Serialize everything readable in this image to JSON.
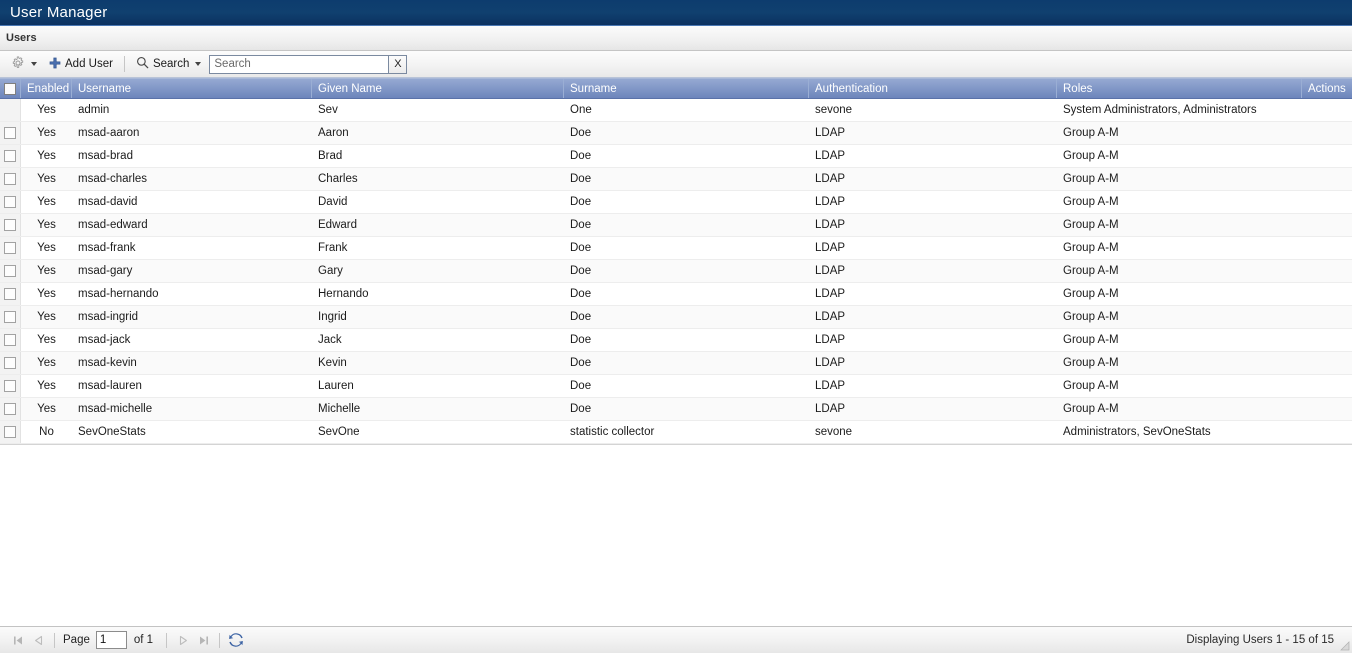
{
  "window": {
    "title": "User Manager"
  },
  "section": {
    "title": "Users"
  },
  "toolbar": {
    "settings_icon": "gear-icon",
    "settings_caret": "chevron-down-icon",
    "add_user_icon": "plus-icon",
    "add_user_label": "Add User",
    "search_icon": "magnifier-icon",
    "search_menu_label": "Search",
    "search_menu_caret": "chevron-down-icon",
    "search_value": "",
    "search_placeholder": "Search",
    "clear_label": "X"
  },
  "grid": {
    "columns": [
      {
        "key": "check",
        "label": ""
      },
      {
        "key": "enabled",
        "label": "Enabled"
      },
      {
        "key": "username",
        "label": "Username"
      },
      {
        "key": "given",
        "label": "Given Name"
      },
      {
        "key": "surname",
        "label": "Surname"
      },
      {
        "key": "auth",
        "label": "Authentication"
      },
      {
        "key": "roles",
        "label": "Roles"
      },
      {
        "key": "actions",
        "label": "Actions"
      }
    ],
    "select_all_checked": false,
    "rows": [
      {
        "checkbox": false,
        "enabled": "Yes",
        "username": "admin",
        "given": "Sev",
        "surname": "One",
        "auth": "sevone",
        "roles": "System Administrators, Administrators",
        "actions": ""
      },
      {
        "checkbox": true,
        "enabled": "Yes",
        "username": "msad-aaron",
        "given": "Aaron",
        "surname": "Doe",
        "auth": "LDAP",
        "roles": "Group A-M",
        "actions": ""
      },
      {
        "checkbox": true,
        "enabled": "Yes",
        "username": "msad-brad",
        "given": "Brad",
        "surname": "Doe",
        "auth": "LDAP",
        "roles": "Group A-M",
        "actions": ""
      },
      {
        "checkbox": true,
        "enabled": "Yes",
        "username": "msad-charles",
        "given": "Charles",
        "surname": "Doe",
        "auth": "LDAP",
        "roles": "Group A-M",
        "actions": ""
      },
      {
        "checkbox": true,
        "enabled": "Yes",
        "username": "msad-david",
        "given": "David",
        "surname": "Doe",
        "auth": "LDAP",
        "roles": "Group A-M",
        "actions": ""
      },
      {
        "checkbox": true,
        "enabled": "Yes",
        "username": "msad-edward",
        "given": "Edward",
        "surname": "Doe",
        "auth": "LDAP",
        "roles": "Group A-M",
        "actions": ""
      },
      {
        "checkbox": true,
        "enabled": "Yes",
        "username": "msad-frank",
        "given": "Frank",
        "surname": "Doe",
        "auth": "LDAP",
        "roles": "Group A-M",
        "actions": ""
      },
      {
        "checkbox": true,
        "enabled": "Yes",
        "username": "msad-gary",
        "given": "Gary",
        "surname": "Doe",
        "auth": "LDAP",
        "roles": "Group A-M",
        "actions": ""
      },
      {
        "checkbox": true,
        "enabled": "Yes",
        "username": "msad-hernando",
        "given": "Hernando",
        "surname": "Doe",
        "auth": "LDAP",
        "roles": "Group A-M",
        "actions": ""
      },
      {
        "checkbox": true,
        "enabled": "Yes",
        "username": "msad-ingrid",
        "given": "Ingrid",
        "surname": "Doe",
        "auth": "LDAP",
        "roles": "Group A-M",
        "actions": ""
      },
      {
        "checkbox": true,
        "enabled": "Yes",
        "username": "msad-jack",
        "given": "Jack",
        "surname": "Doe",
        "auth": "LDAP",
        "roles": "Group A-M",
        "actions": ""
      },
      {
        "checkbox": true,
        "enabled": "Yes",
        "username": "msad-kevin",
        "given": "Kevin",
        "surname": "Doe",
        "auth": "LDAP",
        "roles": "Group A-M",
        "actions": ""
      },
      {
        "checkbox": true,
        "enabled": "Yes",
        "username": "msad-lauren",
        "given": "Lauren",
        "surname": "Doe",
        "auth": "LDAP",
        "roles": "Group A-M",
        "actions": ""
      },
      {
        "checkbox": true,
        "enabled": "Yes",
        "username": "msad-michelle",
        "given": "Michelle",
        "surname": "Doe",
        "auth": "LDAP",
        "roles": "Group A-M",
        "actions": ""
      },
      {
        "checkbox": true,
        "enabled": "No",
        "username": "SevOneStats",
        "given": "SevOne",
        "surname": "statistic collector",
        "auth": "sevone",
        "roles": "Administrators, SevOneStats",
        "actions": ""
      }
    ]
  },
  "footer": {
    "first_icon": "first-page-icon",
    "prev_icon": "previous-page-icon",
    "page_label": "Page",
    "page_value": "1",
    "of_label": "of 1",
    "next_icon": "next-page-icon",
    "last_icon": "last-page-icon",
    "refresh_icon": "refresh-icon",
    "status": "Displaying Users 1 - 15 of 15"
  },
  "colors": {
    "titlebar": "#10406f",
    "grid_header": "#8399c8",
    "accent_blue": "#3b5c94",
    "row_alt": "#fafafa"
  }
}
